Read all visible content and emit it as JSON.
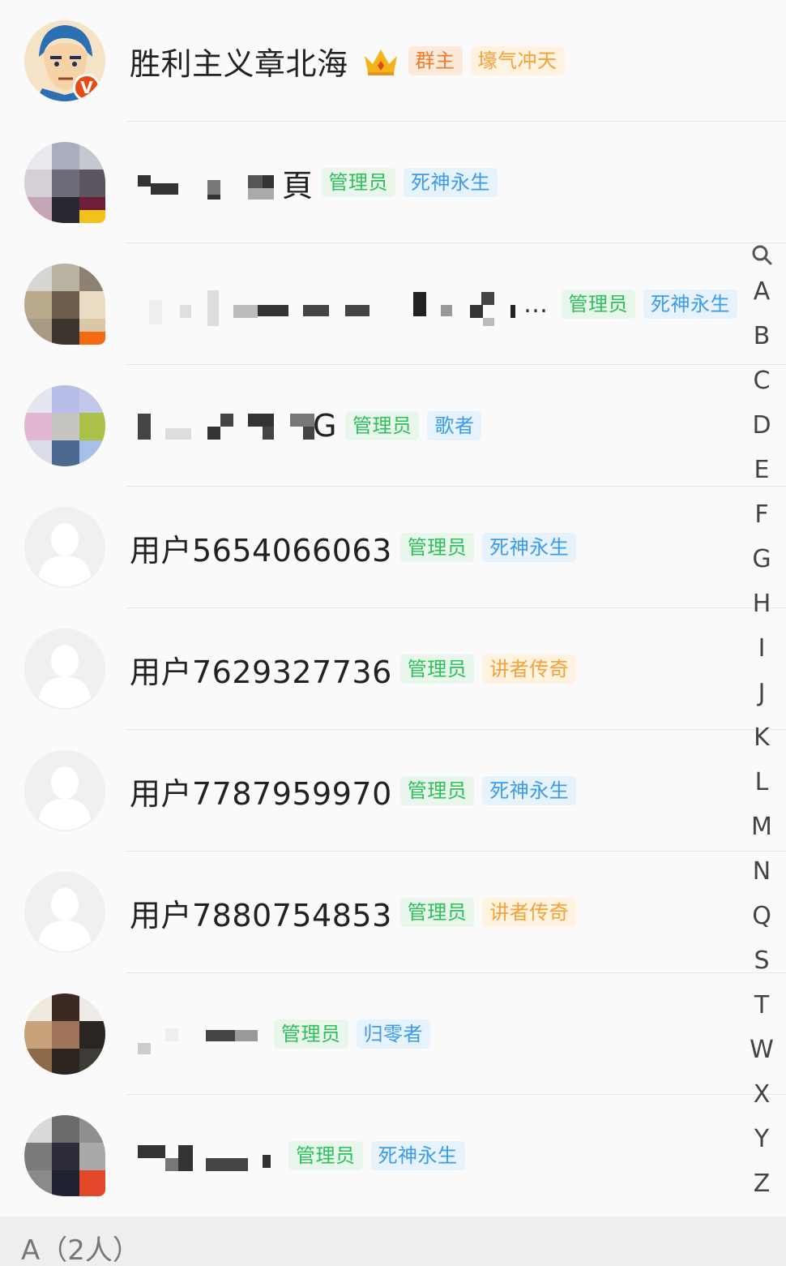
{
  "members": [
    {
      "name": "胜利主义章北海",
      "badges": [
        {
          "label": "群主",
          "style": "owner"
        },
        {
          "label": "壕气冲天",
          "style": "orange"
        }
      ],
      "avatar": "cartoon-avatar"
    },
    {
      "name_tail": "頁",
      "badges": [
        {
          "label": "管理员",
          "style": "admin"
        },
        {
          "label": "死神永生",
          "style": "blue"
        }
      ],
      "avatar": "pixelated-avatar"
    },
    {
      "name_tail": "…",
      "badges": [
        {
          "label": "管理员",
          "style": "admin"
        },
        {
          "label": "死神永生",
          "style": "blue"
        }
      ],
      "avatar": "pixelated-avatar"
    },
    {
      "name_tail": "G",
      "badges": [
        {
          "label": "管理员",
          "style": "admin"
        },
        {
          "label": "歌者",
          "style": "blue"
        }
      ],
      "avatar": "pixelated-avatar"
    },
    {
      "name": "用户5654066063",
      "badges": [
        {
          "label": "管理员",
          "style": "admin"
        },
        {
          "label": "死神永生",
          "style": "blue"
        }
      ],
      "avatar": "default-avatar"
    },
    {
      "name": "用户7629327736",
      "badges": [
        {
          "label": "管理员",
          "style": "admin"
        },
        {
          "label": "讲者传奇",
          "style": "orange"
        }
      ],
      "avatar": "default-avatar"
    },
    {
      "name": "用户7787959970",
      "badges": [
        {
          "label": "管理员",
          "style": "admin"
        },
        {
          "label": "死神永生",
          "style": "blue"
        }
      ],
      "avatar": "default-avatar"
    },
    {
      "name": "用户7880754853",
      "badges": [
        {
          "label": "管理员",
          "style": "admin"
        },
        {
          "label": "讲者传奇",
          "style": "orange"
        }
      ],
      "avatar": "default-avatar"
    },
    {
      "name_tail": "",
      "badges": [
        {
          "label": "管理员",
          "style": "admin"
        },
        {
          "label": "归零者",
          "style": "blue"
        }
      ],
      "avatar": "pixelated-avatar"
    },
    {
      "name_tail": "",
      "badges": [
        {
          "label": "管理员",
          "style": "admin"
        },
        {
          "label": "死神永生",
          "style": "blue"
        }
      ],
      "avatar": "pixelated-avatar"
    }
  ],
  "index_letters": [
    "A",
    "B",
    "C",
    "D",
    "E",
    "F",
    "G",
    "H",
    "I",
    "J",
    "K",
    "L",
    "M",
    "N",
    "Q",
    "S",
    "T",
    "W",
    "X",
    "Y",
    "Z",
    "#"
  ],
  "section_header": "A（2人）",
  "colors": {
    "admin": "#2fbf5a",
    "blue": "#3c9bea",
    "orange": "#f3a23a",
    "owner": "#ef7d2b"
  }
}
